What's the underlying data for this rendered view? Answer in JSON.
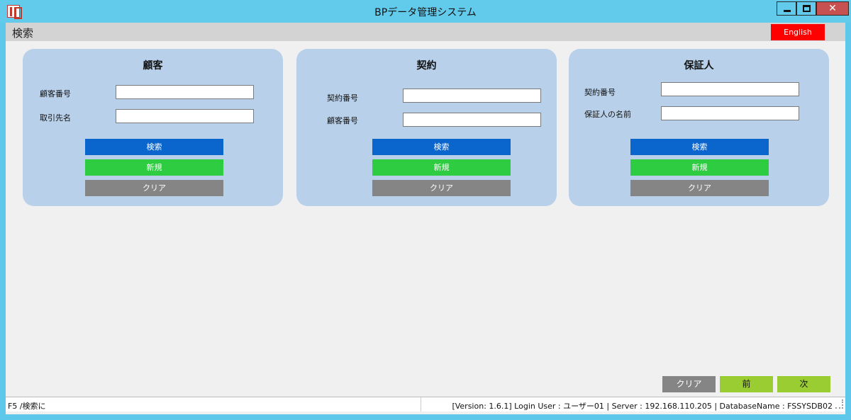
{
  "window": {
    "title": "BPデータ管理システム",
    "close_glyph": "✕"
  },
  "menubar": {
    "title": "検索",
    "language_button": "English"
  },
  "panels": [
    {
      "title": "顧客",
      "fields": [
        {
          "label": "顧客番号",
          "value": ""
        },
        {
          "label": "取引先名",
          "value": ""
        }
      ],
      "buttons": {
        "search": "検索",
        "new": "新規",
        "clear": "クリア"
      }
    },
    {
      "title": "契約",
      "fields": [
        {
          "label": "契約番号",
          "value": ""
        },
        {
          "label": "顧客番号",
          "value": ""
        }
      ],
      "buttons": {
        "search": "検索",
        "new": "新規",
        "clear": "クリア"
      }
    },
    {
      "title": "保証人",
      "fields": [
        {
          "label": "契約番号",
          "value": ""
        },
        {
          "label": "保証人の名前",
          "value": ""
        }
      ],
      "buttons": {
        "search": "検索",
        "new": "新規",
        "clear": "クリア"
      }
    }
  ],
  "footer": {
    "clear": "クリア",
    "prev": "前",
    "next": "次"
  },
  "status": {
    "left": "F5 /検索に",
    "right": "[Version: 1.6.1]  Login User : ユーザー01 | Server : 192.168.110.205 | DatabaseName : FSSYSDB02"
  },
  "colors": {
    "titlebar": "#62cbeb",
    "panel": "#b8d0ea",
    "search_button": "#0a66cc",
    "new_button": "#2ecc40",
    "clear_button": "#858585",
    "nav_button": "#9acd32",
    "language_button": "#fe0000",
    "close_button": "#c75050"
  }
}
